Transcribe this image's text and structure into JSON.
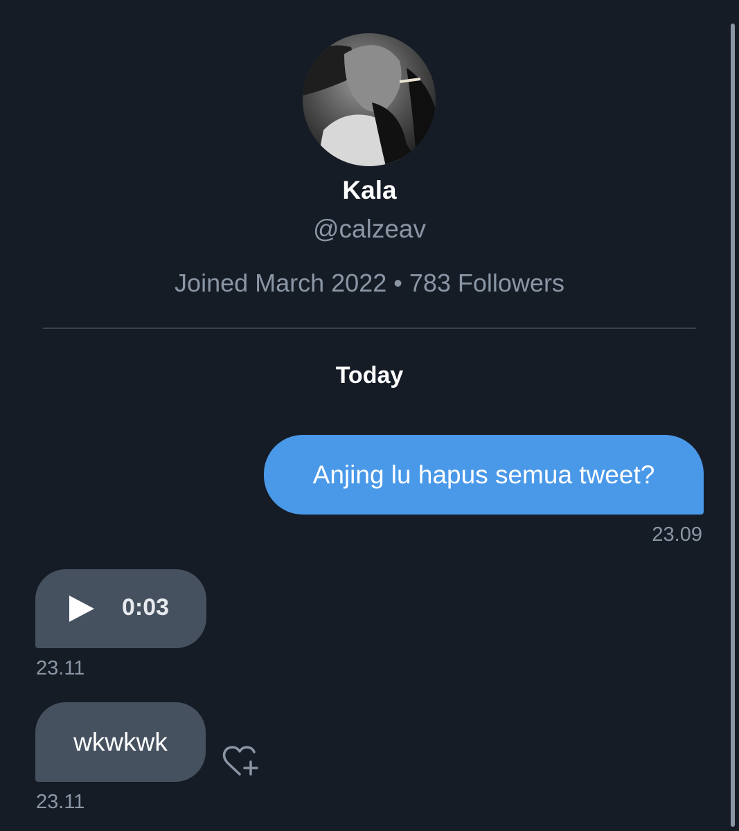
{
  "profile": {
    "name": "Kala",
    "handle": "@calzeav",
    "meta": "Joined March 2022 • 783 Followers"
  },
  "conversation": {
    "date_header": "Today",
    "messages": [
      {
        "direction": "sent",
        "type": "text",
        "text": "Anjing lu hapus semua tweet?",
        "time": "23.09"
      },
      {
        "direction": "received",
        "type": "audio",
        "duration": "0:03",
        "time": "23.11"
      },
      {
        "direction": "received",
        "type": "text",
        "text": "wkwkwk",
        "time": "23.11"
      }
    ]
  },
  "icons": {
    "play": "play-icon",
    "reaction": "heart-add-icon"
  },
  "colors": {
    "background": "#161c26",
    "sent_bubble": "#4a99e9",
    "received_bubble": "#465160",
    "secondary_text": "#8b96a5",
    "divider": "#38434f"
  }
}
